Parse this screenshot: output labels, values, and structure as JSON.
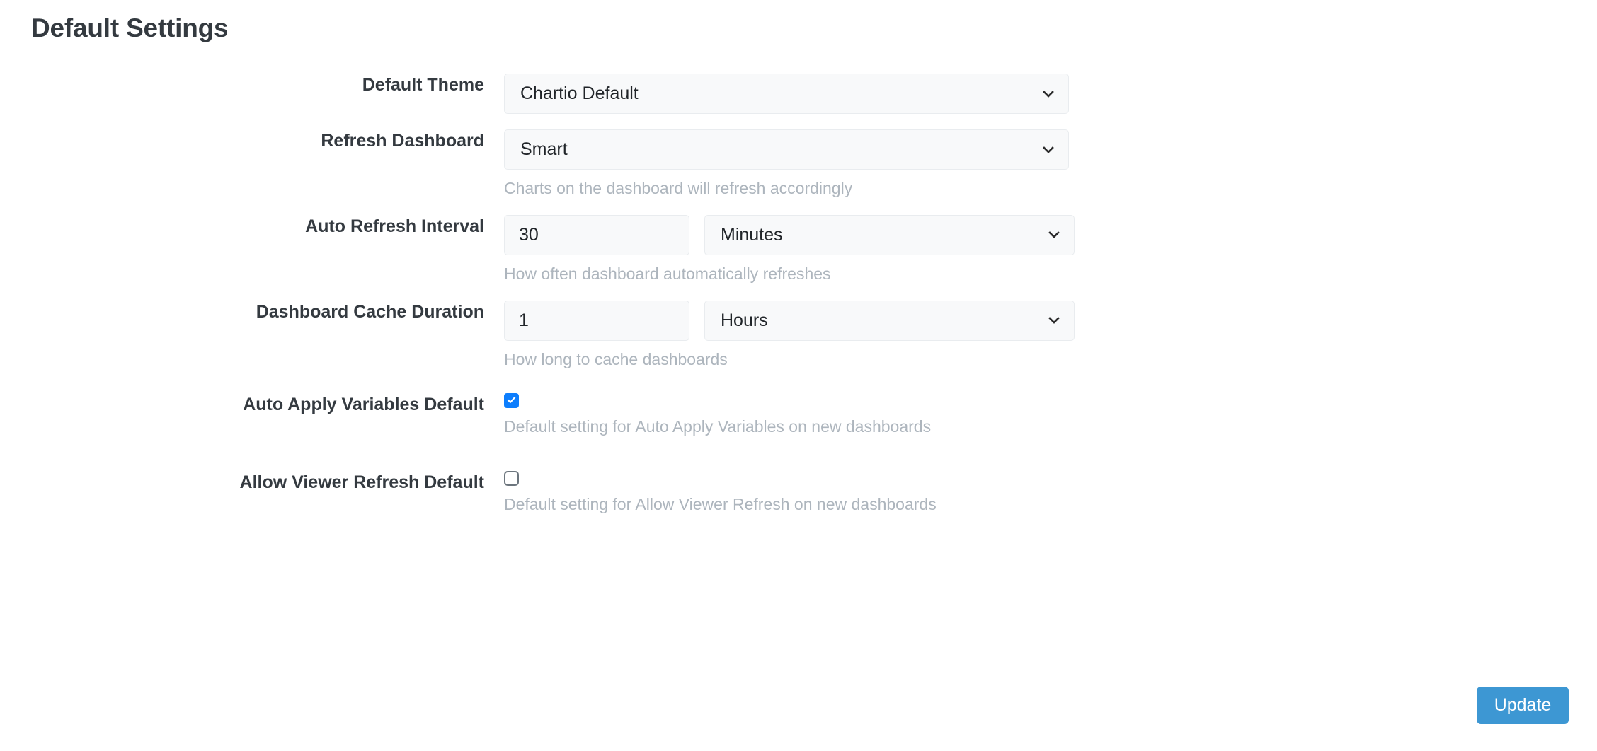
{
  "page": {
    "title": "Default Settings"
  },
  "rows": {
    "theme": {
      "label": "Default Theme",
      "value": "Chartio Default",
      "help": ""
    },
    "refresh_dashboard": {
      "label": "Refresh Dashboard",
      "value": "Smart",
      "help": "Charts on the dashboard will refresh accordingly"
    },
    "auto_refresh_interval": {
      "label": "Auto Refresh Interval",
      "value": "30",
      "unit": "Minutes",
      "help": "How often dashboard automatically refreshes"
    },
    "dashboard_cache_duration": {
      "label": "Dashboard Cache Duration",
      "value": "1",
      "unit": "Hours",
      "help": "How long to cache dashboards"
    },
    "auto_apply_variables_default": {
      "label": "Auto Apply Variables Default",
      "checked": true,
      "help": "Default setting for Auto Apply Variables on new dashboards"
    },
    "allow_viewer_refresh_default": {
      "label": "Allow Viewer Refresh Default",
      "checked": false,
      "help": "Default setting for Allow Viewer Refresh on new dashboards"
    }
  },
  "actions": {
    "update_label": "Update"
  },
  "colors": {
    "accent_button": "#3d97d3",
    "checkbox_checked": "#0d7efd",
    "field_bg": "#f8f9fa",
    "field_border": "#e9ecef",
    "help_text": "#adb5bd",
    "label_text": "#343a40"
  }
}
